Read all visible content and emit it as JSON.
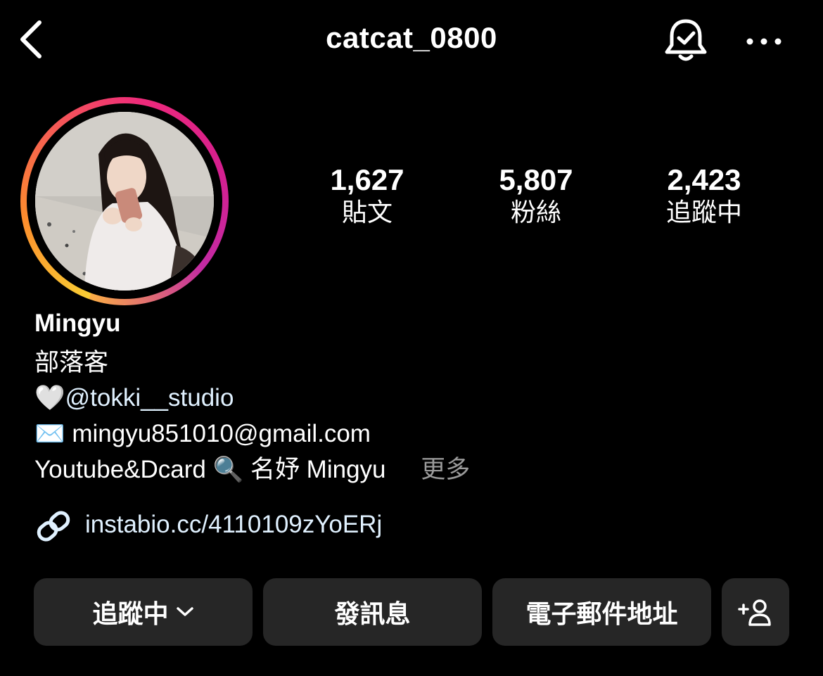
{
  "header": {
    "username": "catcat_0800",
    "back_icon": "chevron-left-icon",
    "notify_icon": "bell-check-icon",
    "more_icon": "more-horizontal-icon"
  },
  "stats": [
    {
      "value": "1,627",
      "label": "貼文"
    },
    {
      "value": "5,807",
      "label": "粉絲"
    },
    {
      "value": "2,423",
      "label": "追蹤中"
    }
  ],
  "profile": {
    "display_name": "Mingyu",
    "category": "部落客",
    "bio_line1_emoji": "🤍",
    "bio_line1_mention": "@tokki__studio",
    "bio_line2_emoji": "✉️",
    "bio_line2_text": "mingyu851010@gmail.com",
    "bio_line3_text_a": "Youtube&Dcard",
    "bio_line3_emoji": "🔍",
    "bio_line3_text_b": "名妤 Mingyu",
    "more_label": "更多",
    "link": "instabio.cc/4110109zYoERj"
  },
  "buttons": {
    "following": "追蹤中",
    "message": "發訊息",
    "email": "電子郵件地址"
  },
  "colors": {
    "background": "#000000",
    "button_bg": "#262626",
    "link": "#e0f1ff",
    "muted": "#9a9a9a"
  }
}
